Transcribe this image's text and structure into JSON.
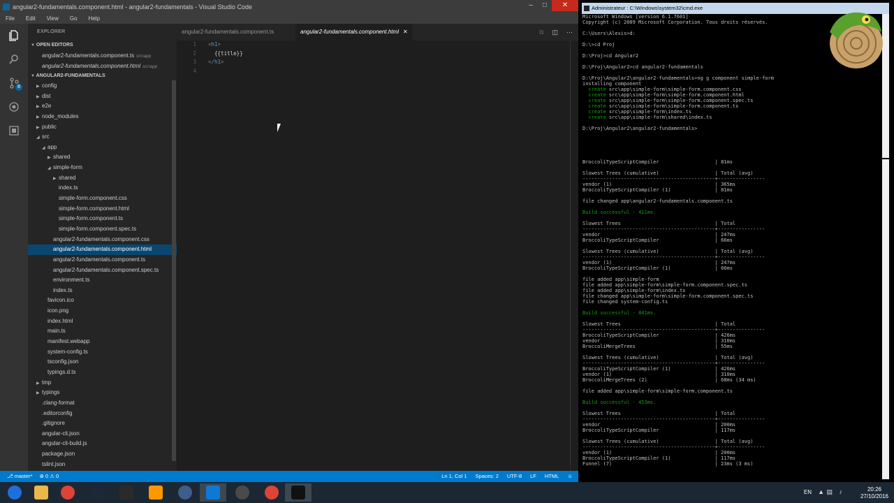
{
  "vscode": {
    "title": "angular2-fundamentals.component.html - angular2-fundamentals - Visual Studio Code",
    "menu": [
      "File",
      "Edit",
      "View",
      "Go",
      "Help"
    ],
    "scm_badge": "8",
    "explorer_title": "EXPLORER",
    "open_editors_header": "OPEN EDITORS",
    "open_editors": [
      {
        "name": "angular2-fundamentals.component.ts",
        "path": "src\\app"
      },
      {
        "name": "angular2-fundamentals.component.html",
        "path": "src\\app"
      }
    ],
    "project_header": "ANGULAR2-FUNDAMENTALS",
    "tree": [
      {
        "label": "config",
        "depth": 0,
        "folder": true,
        "open": false
      },
      {
        "label": "dist",
        "depth": 0,
        "folder": true,
        "open": false
      },
      {
        "label": "e2e",
        "depth": 0,
        "folder": true,
        "open": false
      },
      {
        "label": "node_modules",
        "depth": 0,
        "folder": true,
        "open": false
      },
      {
        "label": "public",
        "depth": 0,
        "folder": true,
        "open": false
      },
      {
        "label": "src",
        "depth": 0,
        "folder": true,
        "open": true
      },
      {
        "label": "app",
        "depth": 1,
        "folder": true,
        "open": true
      },
      {
        "label": "shared",
        "depth": 2,
        "folder": true,
        "open": false
      },
      {
        "label": "simple-form",
        "depth": 2,
        "folder": true,
        "open": true
      },
      {
        "label": "shared",
        "depth": 3,
        "folder": true,
        "open": false
      },
      {
        "label": "index.ts",
        "depth": 3,
        "folder": false
      },
      {
        "label": "simple-form.component.css",
        "depth": 3,
        "folder": false
      },
      {
        "label": "simple-form.component.html",
        "depth": 3,
        "folder": false
      },
      {
        "label": "simple-form.component.ts",
        "depth": 3,
        "folder": false
      },
      {
        "label": "simple-form.component.spec.ts",
        "depth": 3,
        "folder": false
      },
      {
        "label": "angular2-fundamentals.component.css",
        "depth": 2,
        "folder": false
      },
      {
        "label": "angular2-fundamentals.component.html",
        "depth": 2,
        "folder": false,
        "selected": true
      },
      {
        "label": "angular2-fundamentals.component.ts",
        "depth": 2,
        "folder": false
      },
      {
        "label": "angular2-fundamentals.component.spec.ts",
        "depth": 2,
        "folder": false
      },
      {
        "label": "environment.ts",
        "depth": 2,
        "folder": false
      },
      {
        "label": "index.ts",
        "depth": 2,
        "folder": false
      },
      {
        "label": "favicon.ico",
        "depth": 1,
        "folder": false
      },
      {
        "label": "icon.png",
        "depth": 1,
        "folder": false
      },
      {
        "label": "index.html",
        "depth": 1,
        "folder": false
      },
      {
        "label": "main.ts",
        "depth": 1,
        "folder": false
      },
      {
        "label": "manifest.webapp",
        "depth": 1,
        "folder": false
      },
      {
        "label": "system-config.ts",
        "depth": 1,
        "folder": false
      },
      {
        "label": "tsconfig.json",
        "depth": 1,
        "folder": false
      },
      {
        "label": "typings.d.ts",
        "depth": 1,
        "folder": false
      },
      {
        "label": "tmp",
        "depth": 0,
        "folder": true,
        "open": false
      },
      {
        "label": "typings",
        "depth": 0,
        "folder": true,
        "open": false
      },
      {
        "label": ".clang-format",
        "depth": 0,
        "folder": false
      },
      {
        "label": ".editorconfig",
        "depth": 0,
        "folder": false
      },
      {
        "label": ".gitignore",
        "depth": 0,
        "folder": false
      },
      {
        "label": "angular-cli.json",
        "depth": 0,
        "folder": false
      },
      {
        "label": "angular-cli-build.js",
        "depth": 0,
        "folder": false
      },
      {
        "label": "package.json",
        "depth": 0,
        "folder": false
      },
      {
        "label": "tslint.json",
        "depth": 0,
        "folder": false
      }
    ],
    "tabs": [
      {
        "label": "angular2-fundamentals.component.ts",
        "active": false
      },
      {
        "label": "angular2-fundamentals.component.html",
        "active": true
      }
    ],
    "editor_lines": [
      {
        "n": "1",
        "open": "<",
        "tag": "h1",
        "close": ">",
        "text": ""
      },
      {
        "n": "2",
        "text": "  {{title}}"
      },
      {
        "n": "3",
        "open": "</",
        "tag": "h1",
        "close": ">",
        "text": ""
      },
      {
        "n": "4",
        "text": ""
      }
    ],
    "status": {
      "branch": "master*",
      "errors": "0",
      "warnings": "0",
      "position": "Ln 1, Col 1",
      "spaces": "Spaces: 2",
      "encoding": "UTF-8",
      "eol": "LF",
      "language": "HTML"
    }
  },
  "cmd1": {
    "title": "Administrateur : C:\\Windows\\system32\\cmd.exe",
    "lines": [
      {
        "t": "Microsoft Windows [version 6.1.7601]"
      },
      {
        "t": "Copyright (c) 2009 Microsoft Corporation. Tous droits réservés."
      },
      {
        "t": ""
      },
      {
        "t": "C:\\Users\\Alexis>d:"
      },
      {
        "t": ""
      },
      {
        "t": "D:\\>cd Proj"
      },
      {
        "t": ""
      },
      {
        "t": "D:\\Proj>cd Angular2"
      },
      {
        "t": ""
      },
      {
        "t": "D:\\Proj\\Angular2>cd angular2-fundamentals"
      },
      {
        "t": ""
      },
      {
        "t": "D:\\Proj\\Angular2\\angular2-fundamentals>ng g component simple-form"
      },
      {
        "t": "installing component"
      },
      {
        "g": "  create",
        "t": " src\\app\\simple-form\\simple-form.component.css"
      },
      {
        "g": "  create",
        "t": " src\\app\\simple-form\\simple-form.component.html"
      },
      {
        "g": "  create",
        "t": " src\\app\\simple-form\\simple-form.component.spec.ts"
      },
      {
        "g": "  create",
        "t": " src\\app\\simple-form\\simple-form.component.ts"
      },
      {
        "g": "  create",
        "t": " src\\app\\simple-form\\index.ts"
      },
      {
        "g": "  create",
        "t": " src\\app\\simple-form\\shared\\index.ts"
      },
      {
        "t": ""
      },
      {
        "t": "D:\\Proj\\Angular2\\angular2-fundamentals>"
      }
    ]
  },
  "cmd2": {
    "lines": [
      {
        "t": "BroccoliTypeScriptCompiler                   | 81ms"
      },
      {
        "t": ""
      },
      {
        "t": "Slowest Trees (cumulative)                   | Total (avg)"
      },
      {
        "t": "---------------------------------------------+----------------"
      },
      {
        "t": "vendor (1)                                   | 365ms"
      },
      {
        "t": "BroccoliTypeScriptCompiler (1)               | 81ms"
      },
      {
        "t": ""
      },
      {
        "t": "file changed app\\angular2-fundamentals.component.ts"
      },
      {
        "t": ""
      },
      {
        "g": "Build successful - 411ms.",
        "t": ""
      },
      {
        "t": ""
      },
      {
        "t": "Slowest Trees                                | Total"
      },
      {
        "t": "---------------------------------------------+----------------"
      },
      {
        "t": "vendor                                       | 247ms"
      },
      {
        "t": "BroccoliTypeScriptCompiler                   | 66ms"
      },
      {
        "t": ""
      },
      {
        "t": "Slowest Trees (cumulative)                   | Total (avg)"
      },
      {
        "t": "---------------------------------------------+----------------"
      },
      {
        "t": "vendor (1)                                   | 247ms"
      },
      {
        "t": "BroccoliTypeScriptCompiler (1)               | 66ms"
      },
      {
        "t": ""
      },
      {
        "t": "file added app\\simple-form"
      },
      {
        "t": "file added app\\simple-form\\simple-form.component.spec.ts"
      },
      {
        "t": "file added app\\simple-form\\index.ts"
      },
      {
        "t": "file changed app\\simple-form\\simple-form.component.spec.ts"
      },
      {
        "t": "file changed system-config.ts"
      },
      {
        "t": ""
      },
      {
        "g": "Build successful - 841ms.",
        "t": ""
      },
      {
        "t": ""
      },
      {
        "t": "Slowest Trees                                | Total"
      },
      {
        "t": "---------------------------------------------+----------------"
      },
      {
        "t": "BroccoliTypeScriptCompiler                   | 426ms"
      },
      {
        "t": "vendor                                       | 310ms"
      },
      {
        "t": "BroccoliMergeTrees                           | 55ms"
      },
      {
        "t": ""
      },
      {
        "t": "Slowest Trees (cumulative)                   | Total (avg)"
      },
      {
        "t": "---------------------------------------------+----------------"
      },
      {
        "t": "BroccoliTypeScriptCompiler (1)               | 426ms"
      },
      {
        "t": "vendor (1)                                   | 310ms"
      },
      {
        "t": "BroccoliMergeTrees (2)                       | 68ms (34 ms)"
      },
      {
        "t": ""
      },
      {
        "t": "file added app\\simple-form\\simple-form.component.ts"
      },
      {
        "t": ""
      },
      {
        "g": "Build successful - 453ms.",
        "t": ""
      },
      {
        "t": ""
      },
      {
        "t": "Slowest Trees                                | Total"
      },
      {
        "t": "---------------------------------------------+----------------"
      },
      {
        "t": "vendor                                       | 200ms"
      },
      {
        "t": "BroccoliTypeScriptCompiler                   | 117ms"
      },
      {
        "t": ""
      },
      {
        "t": "Slowest Trees (cumulative)                   | Total (avg)"
      },
      {
        "t": "---------------------------------------------+----------------"
      },
      {
        "t": "vendor (1)                                   | 200ms"
      },
      {
        "t": "BroccoliTypeScriptCompiler (1)               | 117ms"
      },
      {
        "t": "Funnel (7)                                   | 23ms (3 ms)"
      }
    ]
  },
  "taskbar": {
    "apps": [
      {
        "icon": "windows-start-icon",
        "color": "#1e6fd9"
      },
      {
        "icon": "file-explorer-icon",
        "color": "#e8b84a"
      },
      {
        "icon": "chrome-icon",
        "color": "#db4437"
      },
      {
        "icon": "steam-icon",
        "color": "#1b2838"
      },
      {
        "icon": "epic-games-icon",
        "color": "#2a2a2a"
      },
      {
        "icon": "sublime-text-icon",
        "color": "#ff9800"
      },
      {
        "icon": "steam-alt-icon",
        "color": "#3f5d8a"
      },
      {
        "icon": "vscode-icon",
        "color": "#0e78d5"
      },
      {
        "icon": "obs-icon",
        "color": "#4a4a4a"
      },
      {
        "icon": "chrome-alt-icon",
        "color": "#db4437"
      },
      {
        "icon": "cmd-icon",
        "color": "#111111"
      }
    ],
    "lang": "EN",
    "time": "20:26",
    "date": "27/10/2016"
  }
}
